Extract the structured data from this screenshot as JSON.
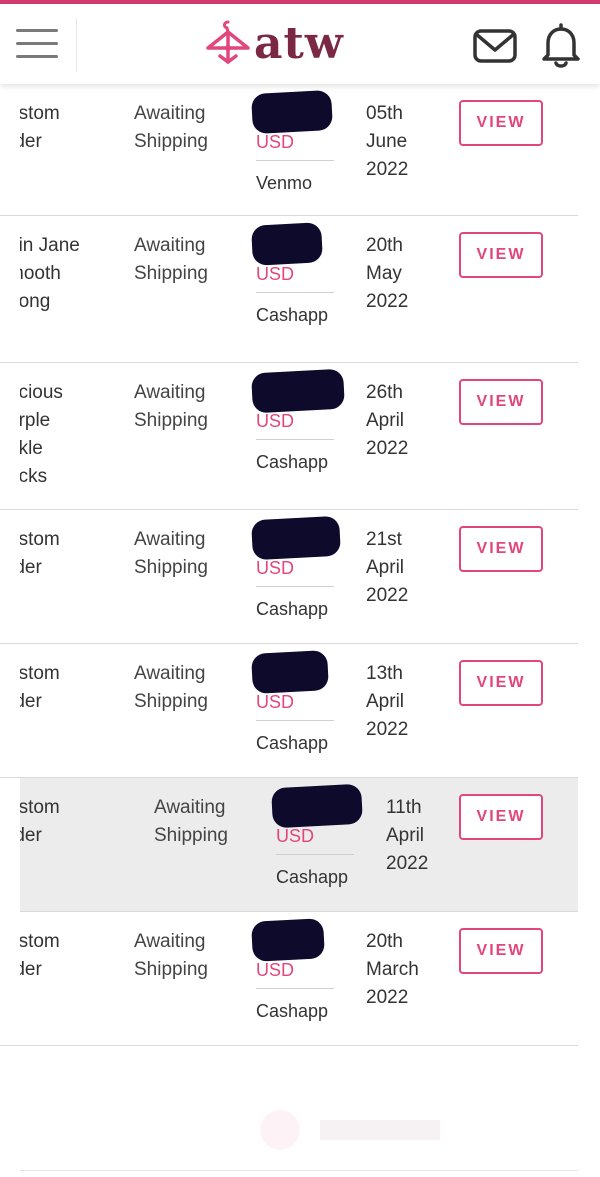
{
  "header": {
    "logo_text": "atw",
    "menu_icon": "hamburger-menu-icon",
    "mail_icon": "envelope-icon",
    "bell_icon": "bell-icon"
  },
  "colors": {
    "accent": "#e2467c",
    "logo": "#7a2844",
    "redaction": "#0e0a2c",
    "highlight_row": "#ececec"
  },
  "orders": [
    {
      "name": "ustom\nrder",
      "status": "Awaiting\nShipping",
      "currency": "USD",
      "method": "Venmo",
      "date": "05th\nJune\n2022",
      "action": "VIEW"
    },
    {
      "name": "ain Jane\nmooth\nhong",
      "status": "Awaiting\nShipping",
      "currency": "USD",
      "method": "Cashapp",
      "date": "20th\nMay\n2022",
      "action": "VIEW"
    },
    {
      "name": "ecious\nurple\nnkle\nocks",
      "status": "Awaiting\nShipping",
      "currency": "USD",
      "method": "Cashapp",
      "date": "26th\nApril\n2022",
      "action": "VIEW"
    },
    {
      "name": "ustom\nrder",
      "status": "Awaiting\nShipping",
      "currency": "USD",
      "method": "Cashapp",
      "date": "21st\nApril\n2022",
      "action": "VIEW"
    },
    {
      "name": "ustom\nrder",
      "status": "Awaiting\nShipping",
      "currency": "USD",
      "method": "Cashapp",
      "date": "13th\nApril\n2022",
      "action": "VIEW"
    },
    {
      "name": "ustom\nrder",
      "status": "Awaiting\nShipping",
      "currency": "USD",
      "method": "Cashapp",
      "date": "11th\nApril\n2022",
      "action": "VIEW",
      "highlighted": true
    },
    {
      "name": "ustom\nrder",
      "status": "Awaiting\nShipping",
      "currency": "USD",
      "method": "Cashapp",
      "date": "20th\nMarch\n2022",
      "action": "VIEW"
    }
  ]
}
